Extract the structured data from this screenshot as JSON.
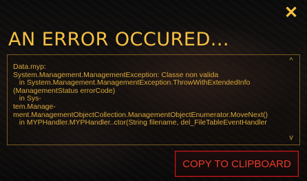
{
  "dialog": {
    "close_icon": "close-icon",
    "close_glyph": "✕",
    "title": "AN ERROR OCCURED...",
    "log": {
      "text": "Data.myp:\nSystem.Management.ManagementException: Classe non valida\n   in System.Management.ManagementException.ThrowWithExtendedInfo\n(ManagementStatus errorCode)\n   in Sys-\ntem.Manage-\nment.ManagementObjectCollection.ManagementObjectEnumerator.MoveNext()\n   in MYPHandler.MYPHandler..ctor(String filename, del_FileTableEventHandler",
      "scroll_up_glyph": "^",
      "scroll_down_glyph": "v"
    },
    "copy_button_label": "COPY TO CLIPBOARD"
  },
  "colors": {
    "accent": "#f6c243",
    "log_text": "#d9a93b",
    "button_border": "#c41818",
    "button_text": "#e83a2b"
  }
}
